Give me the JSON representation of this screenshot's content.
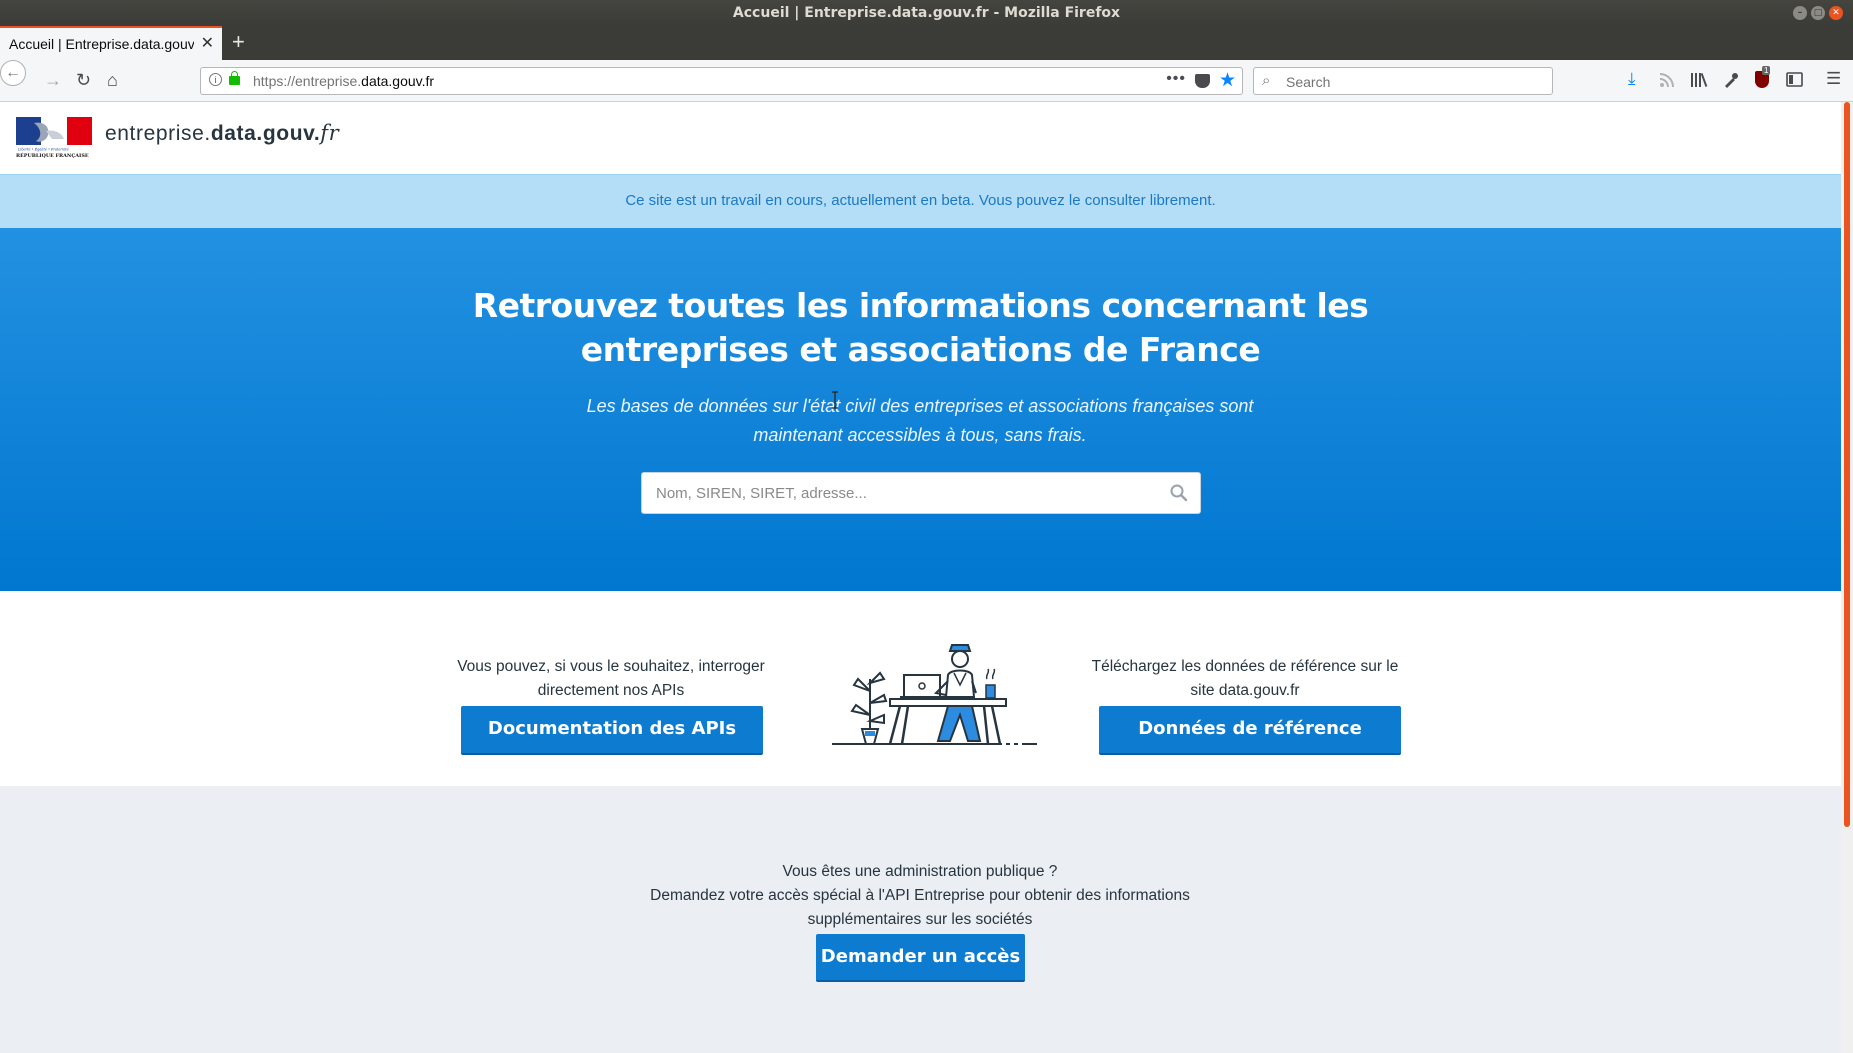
{
  "window": {
    "title": "Accueil | Entreprise.data.gouv.fr - Mozilla Firefox"
  },
  "tabs": [
    {
      "label": "Accueil | Entreprise.data.gouv.fr",
      "active": true
    }
  ],
  "navbar": {
    "url_prefix": "https://entreprise.",
    "url_domain": "data.gouv.fr",
    "search_placeholder": "Search",
    "icons": [
      "back-icon",
      "forward-icon",
      "reload-icon",
      "home-icon",
      "info-icon",
      "lock-icon",
      "more-icon",
      "pocket-icon",
      "bookmark-star-icon",
      "search-icon",
      "download-icon",
      "rss-icon",
      "library-icon",
      "eyedropper-icon",
      "ublock-icon",
      "sidebar-icon",
      "menu-icon"
    ],
    "ublock_badge": "1"
  },
  "site": {
    "logo_caption": "RÉPUBLIQUE FRANÇAISE",
    "logo_motto": "Liberté • Égalité • Fraternité",
    "name_prefix": "entreprise.",
    "name_bold": "data.gouv.",
    "name_suffix": "fr"
  },
  "banner": {
    "text": "Ce site est un travail en cours, actuellement en beta. Vous pouvez le consulter librement."
  },
  "hero": {
    "title": "Retrouvez toutes les informations concernant les entreprises et associations de France",
    "subtitle": "Les bases de données sur l'état civil des entreprises et associations françaises sont maintenant accessibles à tous, sans frais.",
    "search_placeholder": "Nom, SIREN, SIRET, adresse..."
  },
  "cta": {
    "api_text": "Vous pouvez, si vous le souhaitez, interroger directement nos APIs",
    "api_button": "Documentation des APIs",
    "data_text": "Téléchargez les données de référence sur le site data.gouv.fr",
    "data_button": "Données de référence"
  },
  "admin": {
    "line1": "Vous êtes une administration publique ?",
    "line2": "Demandez votre accès spécial à l'API Entreprise pour obtenir des informations supplémentaires sur les sociétés",
    "button": "Demander un accès"
  },
  "colors": {
    "primary": "#0c7bd0",
    "hero_top": "#2391e1",
    "hero_bottom": "#0177d0",
    "banner": "#b4def7",
    "ubuntu_orange": "#e95420"
  }
}
